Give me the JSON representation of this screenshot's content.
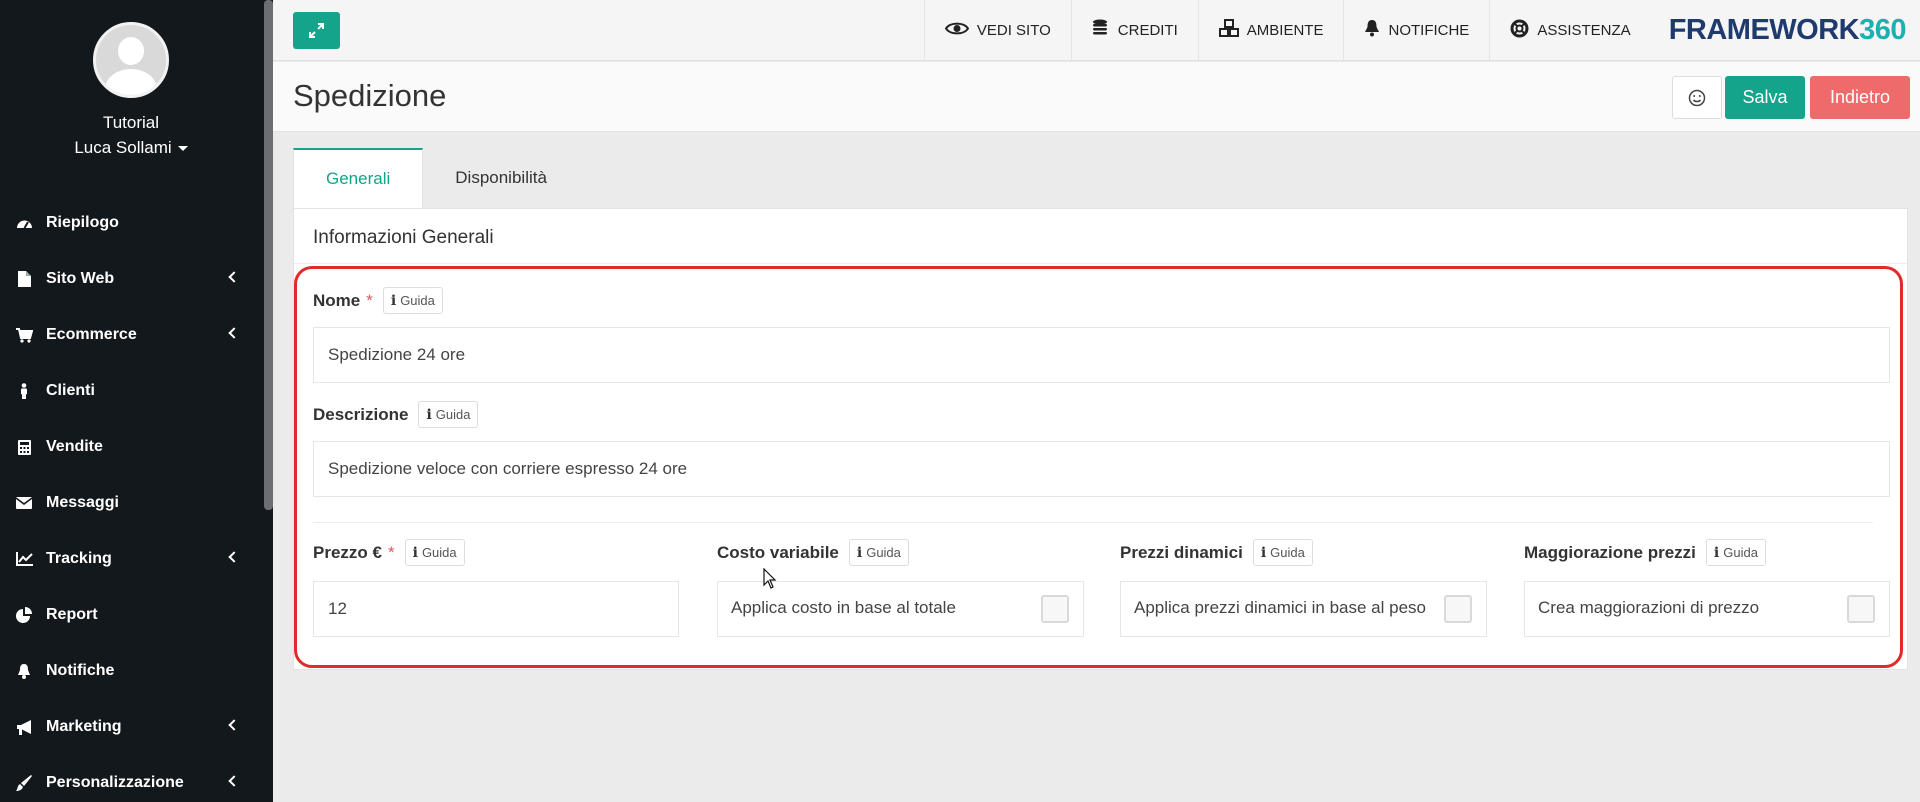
{
  "sidebar": {
    "user_org": "Tutorial",
    "user_name": "Luca Sollami",
    "items": [
      {
        "label": "Riepilogo",
        "icon": "dashboard-icon",
        "has_submenu": false
      },
      {
        "label": "Sito Web",
        "icon": "file-icon",
        "has_submenu": true
      },
      {
        "label": "Ecommerce",
        "icon": "cart-icon",
        "has_submenu": true
      },
      {
        "label": "Clienti",
        "icon": "person-icon",
        "has_submenu": false
      },
      {
        "label": "Vendite",
        "icon": "calculator-icon",
        "has_submenu": false
      },
      {
        "label": "Messaggi",
        "icon": "envelope-icon",
        "has_submenu": false
      },
      {
        "label": "Tracking",
        "icon": "chart-line-icon",
        "has_submenu": true
      },
      {
        "label": "Report",
        "icon": "pie-chart-icon",
        "has_submenu": false
      },
      {
        "label": "Notifiche",
        "icon": "bell-icon",
        "has_submenu": false
      },
      {
        "label": "Marketing",
        "icon": "megaphone-icon",
        "has_submenu": true
      },
      {
        "label": "Personalizzazione",
        "icon": "brush-icon",
        "has_submenu": true
      }
    ]
  },
  "topbar": {
    "links": [
      {
        "label": "VEDI SITO",
        "icon": "eye-icon"
      },
      {
        "label": "CREDITI",
        "icon": "coins-icon"
      },
      {
        "label": "AMBIENTE",
        "icon": "cubes-icon"
      },
      {
        "label": "NOTIFICHE",
        "icon": "bell-icon"
      },
      {
        "label": "ASSISTENZA",
        "icon": "lifering-icon"
      }
    ],
    "brand_main": "FRAMEWORK",
    "brand_num": "360"
  },
  "header": {
    "title": "Spedizione",
    "save_label": "Salva",
    "back_label": "Indietro"
  },
  "tabs": [
    {
      "label": "Generali",
      "active": true
    },
    {
      "label": "Disponibilità",
      "active": false
    }
  ],
  "form": {
    "section_title": "Informazioni Generali",
    "guida_label": "Guida",
    "nome": {
      "label": "Nome",
      "value": "Spedizione 24 ore",
      "required": "*"
    },
    "descrizione": {
      "label": "Descrizione",
      "value": "Spedizione veloce con corriere espresso 24 ore"
    },
    "prezzo": {
      "label": "Prezzo €",
      "value": "12",
      "required": "*"
    },
    "costo_variabile": {
      "label": "Costo variabile",
      "option": "Applica costo in base al totale",
      "checked": false
    },
    "prezzi_dinamici": {
      "label": "Prezzi dinamici",
      "option": "Applica prezzi dinamici in base al peso",
      "checked": false
    },
    "maggiorazione": {
      "label": "Maggiorazione prezzi",
      "option": "Crea maggiorazioni di prezzo",
      "checked": false
    }
  },
  "colors": {
    "accent": "#14a38b",
    "danger": "#ef6a6a",
    "sidebar_bg": "#13181d",
    "highlight": "#e32a2a"
  }
}
